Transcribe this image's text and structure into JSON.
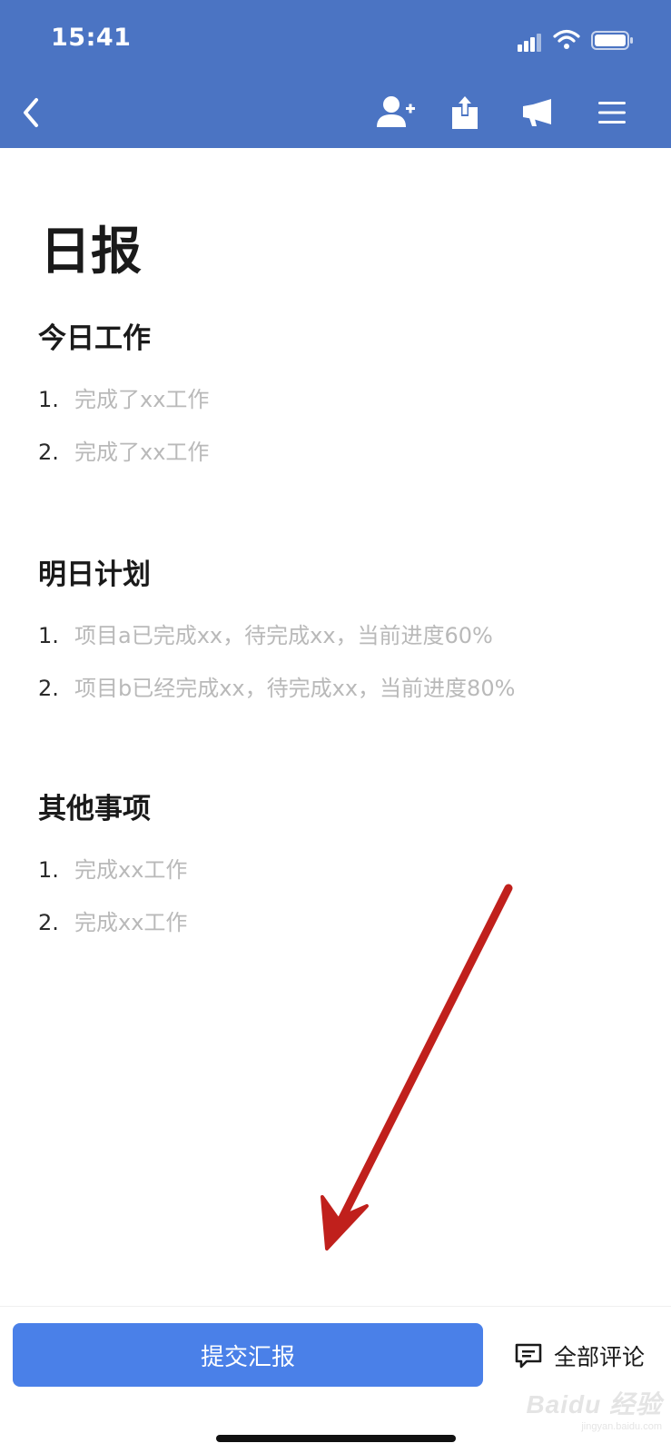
{
  "status_bar": {
    "time": "15:41"
  },
  "colors": {
    "header_bg": "#4b74c3",
    "submit_bg": "#4a80e8",
    "placeholder_text": "#b9b9b9",
    "annotation_arrow": "#c0201c"
  },
  "nav": {
    "icons": [
      "back-chevron-icon",
      "add-member-icon",
      "share-icon",
      "megaphone-icon",
      "menu-icon"
    ]
  },
  "document": {
    "title": "日报",
    "sections": [
      {
        "heading": "今日工作",
        "items": [
          {
            "num": "1.",
            "text": "完成了xx工作"
          },
          {
            "num": "2.",
            "text": "完成了xx工作"
          }
        ]
      },
      {
        "heading": "明日计划",
        "items": [
          {
            "num": "1.",
            "text": "项目a已完成xx，待完成xx，当前进度60%"
          },
          {
            "num": "2.",
            "text": "项目b已经完成xx，待完成xx，当前进度80%"
          }
        ]
      },
      {
        "heading": "其他事项",
        "items": [
          {
            "num": "1.",
            "text": "完成xx工作"
          },
          {
            "num": "2.",
            "text": "完成xx工作"
          }
        ]
      }
    ]
  },
  "bottom_bar": {
    "submit_label": "提交汇报",
    "comments_label": "全部评论"
  },
  "watermark": {
    "brand": "Baidu 经验",
    "url": "jingyan.baidu.com"
  }
}
